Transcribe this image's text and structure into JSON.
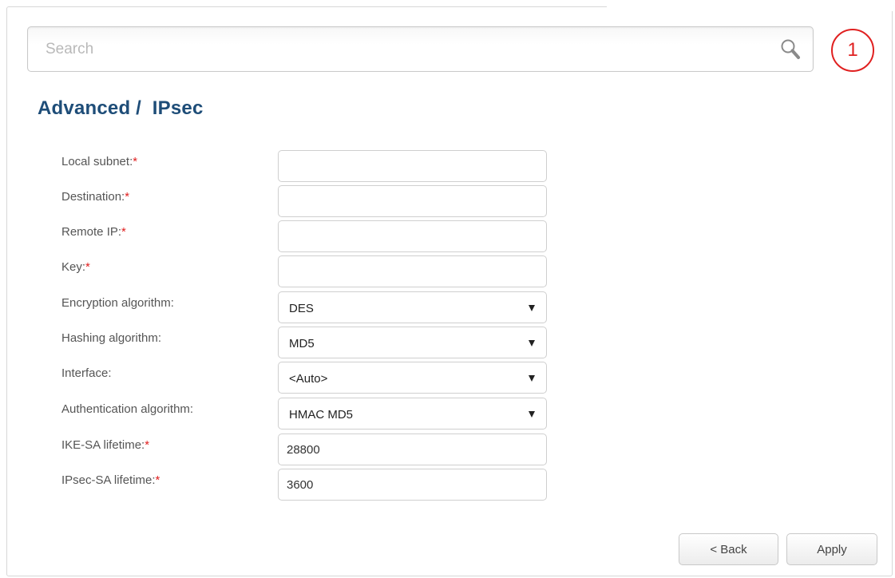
{
  "search": {
    "placeholder": "Search"
  },
  "notifications": {
    "count": "1"
  },
  "page": {
    "title": "Advanced /  IPsec"
  },
  "form": {
    "fields": [
      {
        "label": "Local subnet:",
        "required": "*",
        "value": ""
      },
      {
        "label": "Destination:",
        "required": "*",
        "value": ""
      },
      {
        "label": "Remote IP:",
        "required": "*",
        "value": ""
      },
      {
        "label": "Key:",
        "required": "*",
        "value": ""
      },
      {
        "label": "Encryption algorithm:",
        "required": "",
        "value": "DES"
      },
      {
        "label": "Hashing algorithm:",
        "required": "",
        "value": "MD5"
      },
      {
        "label": "Interface:",
        "required": "",
        "value": "<Auto>"
      },
      {
        "label": "Authentication algorithm:",
        "required": "",
        "value": "HMAC MD5"
      },
      {
        "label": "IKE-SA lifetime:",
        "required": "*",
        "value": "28800"
      },
      {
        "label": "IPsec-SA lifetime:",
        "required": "*",
        "value": "3600"
      }
    ]
  },
  "buttons": {
    "back": "< Back",
    "apply": "Apply"
  },
  "colors": {
    "title": "#1e4d78",
    "required": "#e02020",
    "badge": "#e02020"
  }
}
